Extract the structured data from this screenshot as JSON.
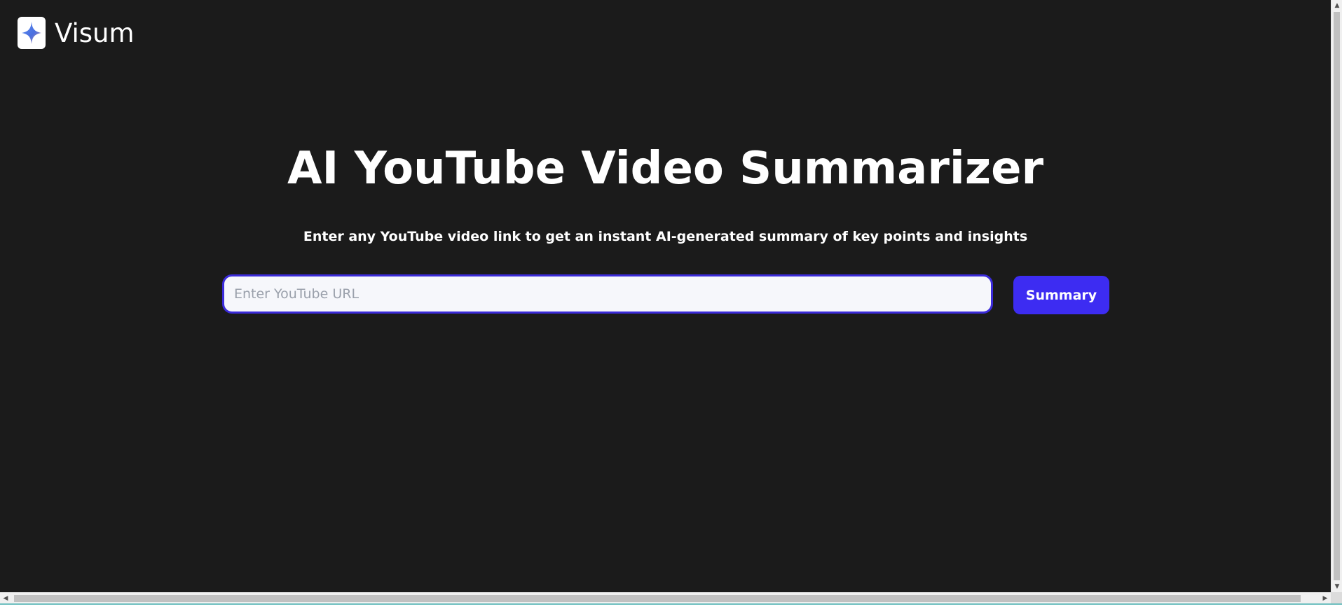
{
  "brand": {
    "name": "Visum",
    "logo_icon": "sparkle-icon"
  },
  "hero": {
    "title": "AI YouTube Video Summarizer",
    "subtitle": "Enter any YouTube video link to get an instant AI-generated summary of key points and insights"
  },
  "form": {
    "url_placeholder": "Enter YouTube URL",
    "url_value": "",
    "submit_label": "Summary"
  },
  "colors": {
    "background": "#1b1b1b",
    "accent": "#3d2cf2",
    "input_border": "#3b2bd9"
  }
}
